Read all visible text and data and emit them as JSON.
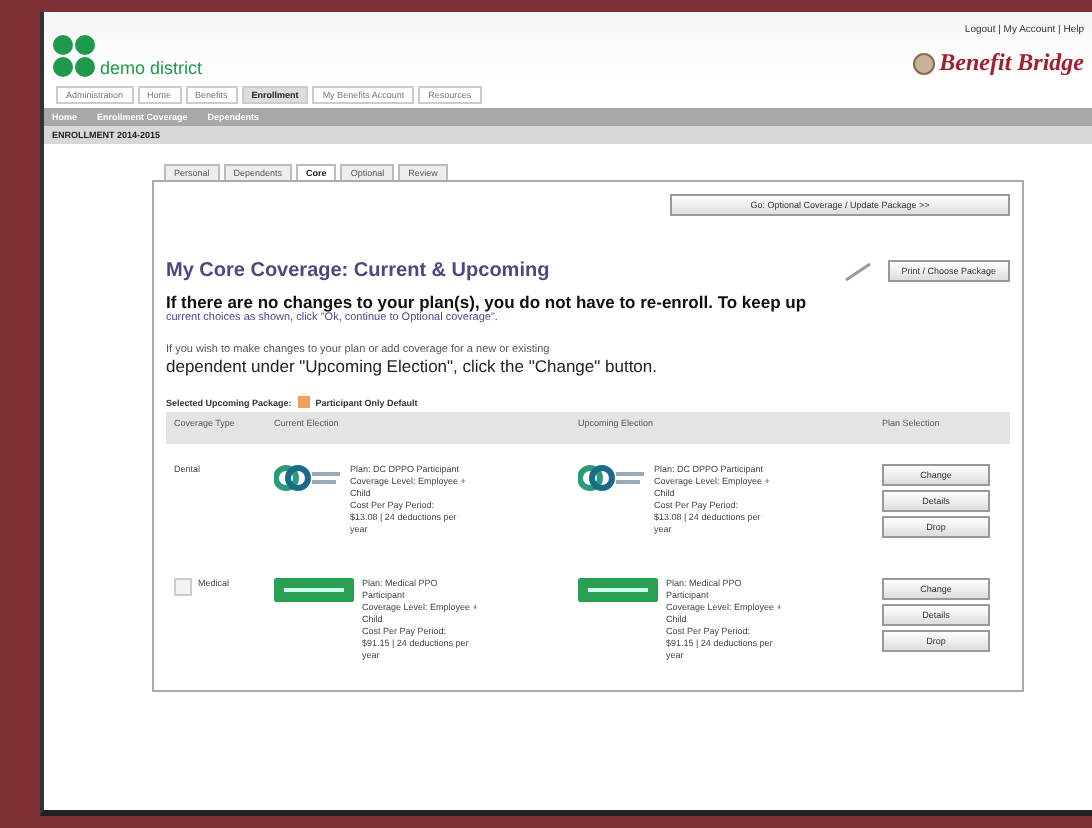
{
  "header": {
    "brand": "demo district",
    "top_links": "Logout | My Account | Help",
    "product": "Benefit Bridge"
  },
  "nav_tabs": [
    {
      "label": "Administration",
      "selected": false
    },
    {
      "label": "Home",
      "selected": false
    },
    {
      "label": "Benefits",
      "selected": false
    },
    {
      "label": "Enrollment",
      "selected": true
    },
    {
      "label": "My Benefits Account",
      "selected": false
    },
    {
      "label": "Resources",
      "selected": false
    }
  ],
  "sub_nav": [
    "Home",
    "Enrollment Coverage",
    "Dependents"
  ],
  "section_bar": "ENROLLMENT 2014-2015",
  "steps": [
    {
      "label": "Personal",
      "selected": false
    },
    {
      "label": "Dependents",
      "selected": false
    },
    {
      "label": "Core",
      "selected": true
    },
    {
      "label": "Optional",
      "selected": false
    },
    {
      "label": "Review",
      "selected": false
    }
  ],
  "top_button": "Go: Optional Coverage / Update Package >>",
  "heading": "My Core Coverage: Current & Upcoming",
  "side_button": "Print / Choose Package",
  "intro": "If there are no changes to your plan(s), you do not have to re-enroll.  To keep up",
  "intro_link_line": "current choices as shown, click \"Ok, continue to Optional coverage\".",
  "note_small": "If you wish to make changes to your plan or add coverage for a new or existing",
  "note": "dependent under \"Upcoming Election\", click the \"Change\" button.",
  "package_label": "Selected Upcoming Package:",
  "package_value": "Participant Only Default",
  "columns": [
    "Coverage Type",
    "Current Election",
    "Upcoming Election",
    "Plan Selection"
  ],
  "rows": [
    {
      "type": "Dental",
      "kind": "chain",
      "current": [
        "Plan: DC DPPO Participant",
        "Coverage Level: Employee +",
        "Child",
        "Cost Per Pay Period:",
        "$13.08 | 24 deductions per",
        "year"
      ],
      "upcoming": [
        "Plan: DC DPPO Participant",
        "Coverage Level: Employee +",
        "Child",
        "Cost Per Pay Period:",
        "$13.08 | 24 deductions per",
        "year"
      ],
      "buttons": [
        "Change",
        "Details",
        "Drop"
      ]
    },
    {
      "type": "Medical",
      "checked": false,
      "kind": "badge",
      "current": [
        "Plan: Medical PPO",
        "Participant",
        "Coverage Level: Employee +",
        "Child",
        "Cost Per Pay Period:",
        "$91.15 | 24 deductions per",
        "year"
      ],
      "upcoming": [
        "Plan: Medical PPO",
        "Participant",
        "Coverage Level: Employee +",
        "Child",
        "Cost Per Pay Period:",
        "$91.15 | 24 deductions per",
        "year"
      ],
      "buttons": [
        "Change",
        "Details",
        "Drop"
      ]
    }
  ]
}
